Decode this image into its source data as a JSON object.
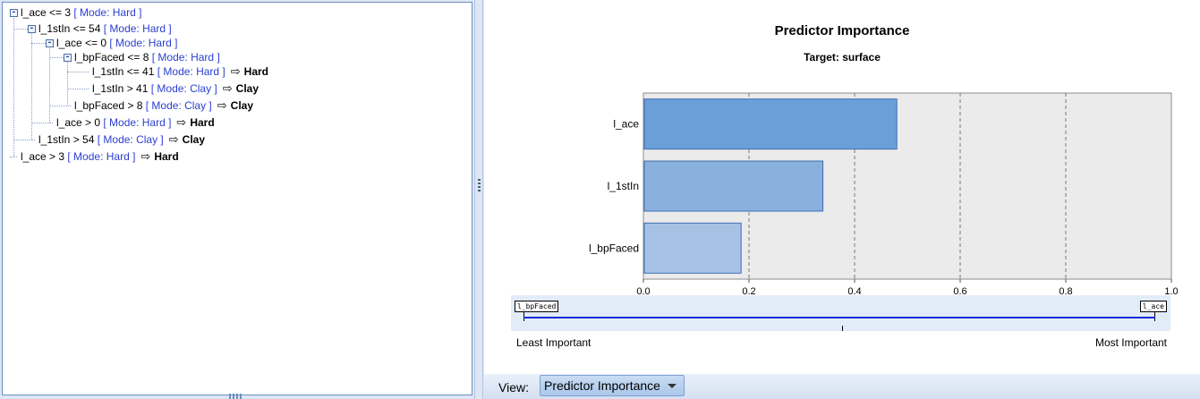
{
  "tree": {
    "nodes": [
      {
        "label": "l_ace <= 3",
        "mode": "[ Mode: Hard ]",
        "prediction": ""
      },
      {
        "label": "l_1stIn <= 54",
        "mode": "[ Mode: Hard ]",
        "prediction": ""
      },
      {
        "label": "l_ace <= 0",
        "mode": "[ Mode: Hard ]",
        "prediction": ""
      },
      {
        "label": "l_bpFaced <= 8",
        "mode": "[ Mode: Hard ]",
        "prediction": ""
      },
      {
        "label": "l_1stIn <= 41",
        "mode": "[ Mode: Hard ]",
        "prediction": "Hard"
      },
      {
        "label": "l_1stIn > 41",
        "mode": "[ Mode: Clay ]",
        "prediction": "Clay"
      },
      {
        "label": "l_bpFaced > 8",
        "mode": "[ Mode: Clay ]",
        "prediction": "Clay"
      },
      {
        "label": "l_ace > 0",
        "mode": "[ Mode: Hard ]",
        "prediction": "Hard"
      },
      {
        "label": "l_1stIn > 54",
        "mode": "[ Mode: Clay ]",
        "prediction": "Clay"
      },
      {
        "label": "l_ace > 3",
        "mode": "[ Mode: Hard ]",
        "prediction": "Hard"
      }
    ],
    "arrow_glyph": "⇨",
    "expander_glyph": "-"
  },
  "chart_data": {
    "type": "bar",
    "orientation": "horizontal",
    "title": "Predictor Importance",
    "subtitle": "Target: surface",
    "categories": [
      "l_ace",
      "l_1stIn",
      "l_bpFaced"
    ],
    "values": [
      0.48,
      0.34,
      0.185
    ],
    "xlim": [
      0,
      1.0
    ],
    "xticks": [
      "0.0",
      "0.2",
      "0.4",
      "0.6",
      "0.8",
      "1.0"
    ],
    "grid": "vertical dashed",
    "colors": [
      "#6a9fd8",
      "#8ab0de",
      "#a5c2e4"
    ],
    "background": "#ebebeb"
  },
  "slider": {
    "left_tag": "l_bpFaced",
    "right_tag": "l_ace",
    "least_label": "Least Important",
    "most_label": "Most Important"
  },
  "footer": {
    "view_label": "View:",
    "view_value": "Predictor Importance"
  }
}
